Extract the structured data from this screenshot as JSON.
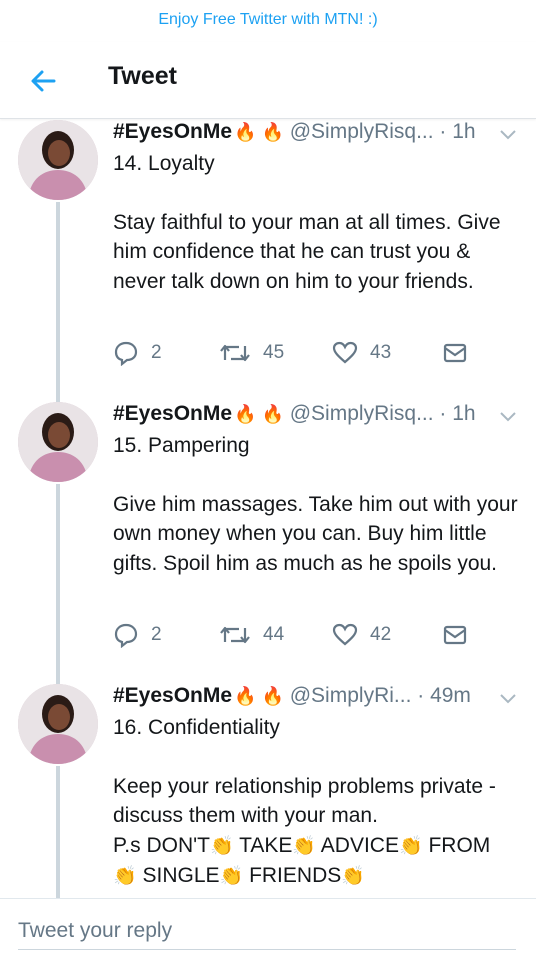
{
  "banner": {
    "text": "Enjoy Free Twitter with MTN! :)"
  },
  "header": {
    "title": "Tweet",
    "back_icon": "arrow-left-icon"
  },
  "colors": {
    "accent": "#1da1f2",
    "secondary_text": "#657786",
    "thread_line": "#ccd6dd"
  },
  "tweets": [
    {
      "name": "#EyesOnMe",
      "emoji": "🔥 🔥",
      "handle": "@SimplyRisq...",
      "time": "· 1h",
      "title": "14. Loyalty",
      "text": "Stay faithful to your man at all times. Give him confidence that he can trust you & never talk down on him to your friends.",
      "replies": "2",
      "retweets": "45",
      "likes": "43"
    },
    {
      "name": "#EyesOnMe",
      "emoji": "🔥 🔥",
      "handle": "@SimplyRisq...",
      "time": "· 1h",
      "title": "15. Pampering",
      "text": "Give him massages. Take him out with your own money when you can. Buy him little gifts. Spoil him as much as he spoils you.",
      "replies": "2",
      "retweets": "44",
      "likes": "42"
    },
    {
      "name": "#EyesOnMe",
      "emoji": "🔥 🔥",
      "handle": "@SimplyRi...",
      "time": "· 49m",
      "title": "16. Confidentiality",
      "text": "Keep your relationship problems private - discuss them with your man.",
      "ps": {
        "w1": "P.s DON'T",
        "w2": "TAKE",
        "w3": "ADVICE",
        "w4": "FROM",
        "w5": "SINGLE",
        "w6": "FRIENDS",
        "clap": "👏"
      }
    }
  ],
  "reply": {
    "placeholder": "Tweet your reply"
  }
}
